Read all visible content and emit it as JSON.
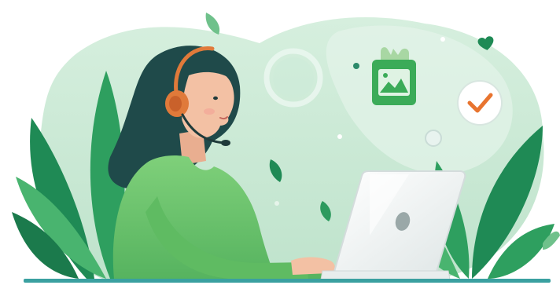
{
  "illustration": {
    "subject": "support-agent-with-headset-at-laptop",
    "icons": [
      "checkmark-badge-icon",
      "image-lock-icon",
      "heart-icon",
      "leaf-icon"
    ],
    "colors": {
      "background_blob": "#cfe9d8",
      "blob_light": "#e4f4e9",
      "leaf_dark": "#1f8a55",
      "leaf_light": "#49b46f",
      "shirt": "#6cc46a",
      "hair": "#1f4a4a",
      "skin": "#f3c1a4",
      "headset": "#e07a3a",
      "laptop": "#f4f6f6",
      "check": "#e8742f",
      "desk_line": "#3aa0a0"
    }
  }
}
